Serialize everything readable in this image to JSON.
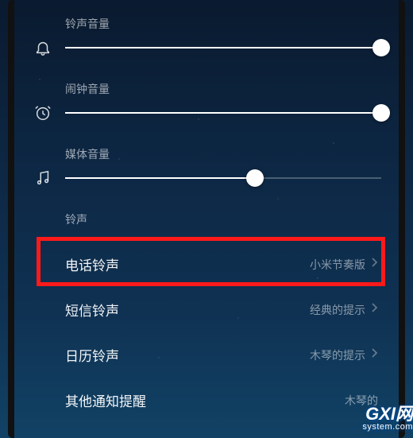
{
  "sliders": {
    "ringtone": {
      "label": "铃声音量",
      "value": 100
    },
    "alarm": {
      "label": "闹钟音量",
      "value": 100
    },
    "media": {
      "label": "媒体音量",
      "value": 60
    }
  },
  "section_header": "铃声",
  "items": {
    "phone_ringtone": {
      "title": "电话铃声",
      "value": "小米节奏版"
    },
    "sms_ringtone": {
      "title": "短信铃声",
      "value": "经典的提示"
    },
    "calendar_ringtone": {
      "title": "日历铃声",
      "value": "木琴的提示"
    },
    "other_notification": {
      "title": "其他通知提醒",
      "value": "木琴的"
    }
  },
  "watermark": {
    "main": "GXI网",
    "sub": "system.com"
  }
}
